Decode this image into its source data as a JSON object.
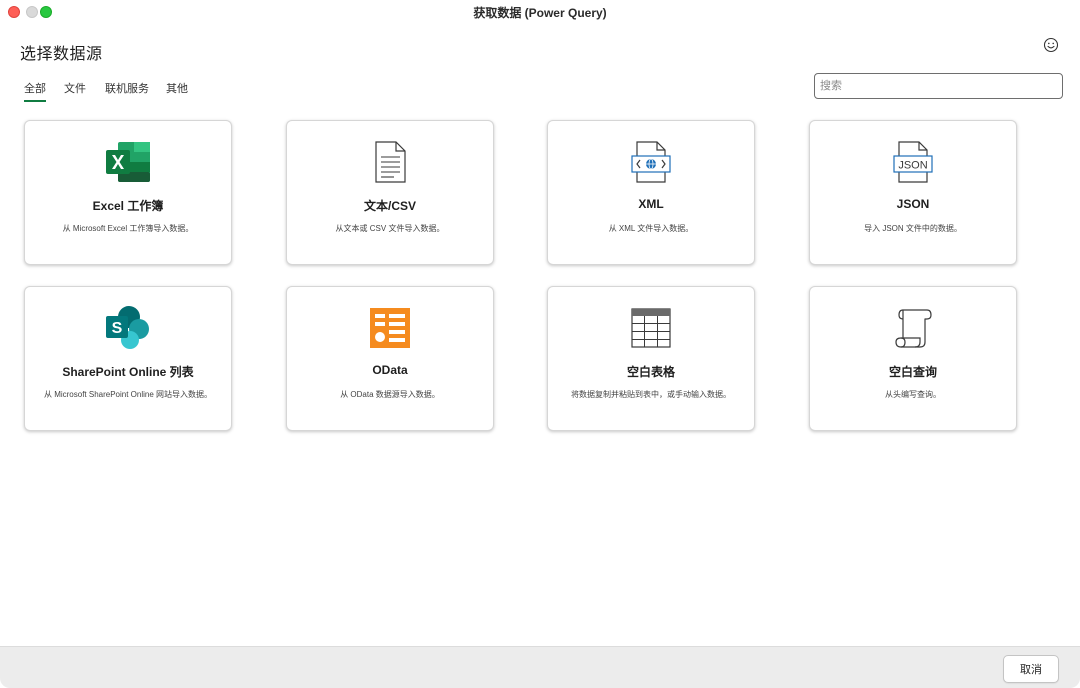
{
  "window": {
    "title": "获取数据 (Power Query)"
  },
  "header": {
    "title": "选择数据源",
    "feedback_icon": "smiley-icon"
  },
  "tabs": [
    {
      "label": "全部",
      "active": true
    },
    {
      "label": "文件",
      "active": false
    },
    {
      "label": "联机服务",
      "active": false
    },
    {
      "label": "其他",
      "active": false
    }
  ],
  "search": {
    "placeholder": "搜索",
    "value": ""
  },
  "sources": [
    {
      "title": "Excel 工作簿",
      "desc": "从 Microsoft Excel 工作簿导入数据。",
      "icon": "excel-icon"
    },
    {
      "title": "文本/CSV",
      "desc": "从文本或 CSV 文件导入数据。",
      "icon": "document-icon"
    },
    {
      "title": "XML",
      "desc": "从 XML 文件导入数据。",
      "icon": "xml-icon"
    },
    {
      "title": "JSON",
      "desc": "导入 JSON 文件中的数据。",
      "icon": "json-icon"
    },
    {
      "title": "SharePoint Online 列表",
      "desc": "从 Microsoft SharePoint Online 网站导入数据。",
      "icon": "sharepoint-icon"
    },
    {
      "title": "OData",
      "desc": "从 OData 数据源导入数据。",
      "icon": "odata-icon"
    },
    {
      "title": "空白表格",
      "desc": "将数据复制并粘贴到表中，或手动输入数据。",
      "icon": "table-icon"
    },
    {
      "title": "空白查询",
      "desc": "从头编写查询。",
      "icon": "scroll-icon"
    }
  ],
  "footer": {
    "cancel_label": "取消"
  },
  "colors": {
    "excel_green": "#107c41",
    "sharepoint_teal": "#038387",
    "odata_orange": "#f58b1f",
    "xml_blue": "#1e6fb8",
    "tab_underline": "#107c41"
  }
}
